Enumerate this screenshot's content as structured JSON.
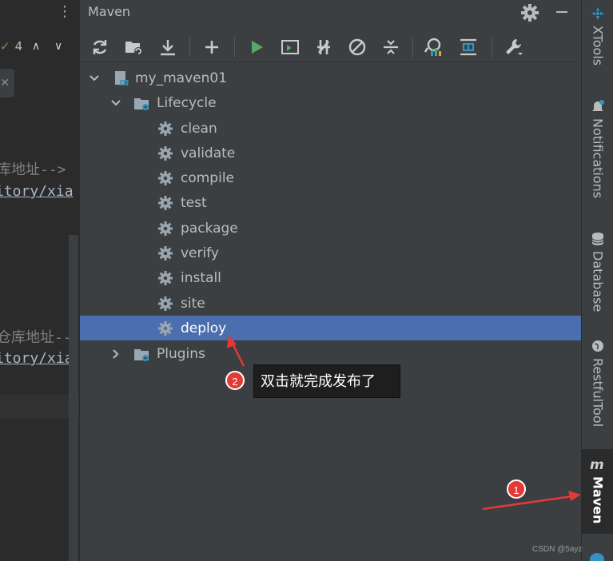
{
  "editor": {
    "warning_count": "4",
    "line1_comment": "库地址-->",
    "line2_text": "itory/xia",
    "line3_comment": "仓库地址--",
    "line4_text": "itory/xia"
  },
  "panel": {
    "title": "Maven",
    "toolbar_icons": [
      "reload-icon",
      "add-folder-icon",
      "download-icon",
      "plus-icon",
      "run-icon",
      "console-icon",
      "toggle-offline-icon",
      "skip-tests-icon",
      "collapse-icon",
      "analyze-icon",
      "show-dependencies-icon",
      "settings-wrench-icon"
    ]
  },
  "tree": {
    "project": "my_maven01",
    "lifecycle": "Lifecycle",
    "phases": [
      "clean",
      "validate",
      "compile",
      "test",
      "package",
      "verify",
      "install",
      "site",
      "deploy"
    ],
    "selected_phase": "deploy",
    "plugins": "Plugins"
  },
  "right_strip": {
    "tabs": [
      "XTools",
      "Notifications",
      "Database",
      "RestfulTool",
      "Maven"
    ],
    "active_tab": "Maven"
  },
  "annotations": {
    "badge1": "1",
    "badge2": "2",
    "tooltip": "双击就完成发布了",
    "color": "#e53935"
  },
  "watermark": "CSDN @5ayz",
  "colors": {
    "selection": "#4b6eaf",
    "run_green": "#59a869",
    "accent_blue": "#3592c4"
  }
}
